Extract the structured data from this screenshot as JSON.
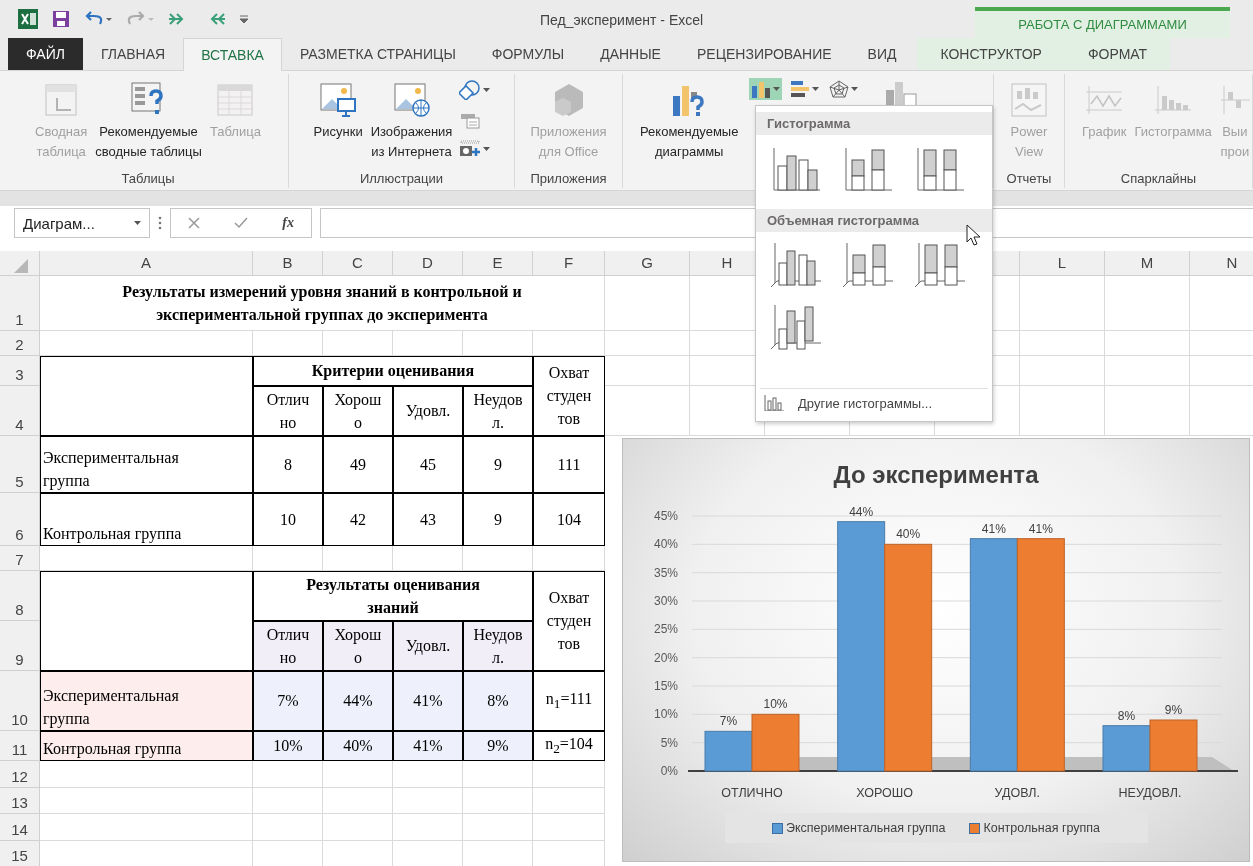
{
  "title_bar": {
    "title": "Пед_эксперимент - Excel",
    "context_group": "РАБОТА С ДИАГРАММАМИ"
  },
  "tabs": [
    {
      "label": "ФАЙЛ",
      "kind": "file",
      "selected": false
    },
    {
      "label": "ГЛАВНАЯ",
      "kind": "main",
      "selected": false
    },
    {
      "label": "ВСТАВКА",
      "kind": "main",
      "selected": true
    },
    {
      "label": "РАЗМЕТКА СТРАНИЦЫ",
      "kind": "main",
      "selected": false
    },
    {
      "label": "ФОРМУЛЫ",
      "kind": "main",
      "selected": false
    },
    {
      "label": "ДАННЫЕ",
      "kind": "main",
      "selected": false
    },
    {
      "label": "РЕЦЕНЗИРОВАНИЕ",
      "kind": "main",
      "selected": false
    },
    {
      "label": "ВИД",
      "kind": "main",
      "selected": false
    },
    {
      "label": "КОНСТРУКТОР",
      "kind": "context",
      "selected": false
    },
    {
      "label": "ФОРМАТ",
      "kind": "context",
      "selected": false
    }
  ],
  "ribbon_groups": [
    {
      "label": "Таблицы",
      "buttons": [
        {
          "kind": "pivot",
          "label": "Сводная\nтаблица",
          "disabled": true
        },
        {
          "kind": "recommended-pivot",
          "label": "Рекомендуемые\nсводные таблицы",
          "disabled": false
        },
        {
          "kind": "table",
          "label": "Таблица",
          "disabled": true
        }
      ]
    },
    {
      "label": "Иллюстрации",
      "buttons": [
        {
          "kind": "pictures",
          "label": "Рисунки",
          "disabled": false
        },
        {
          "kind": "online-pictures",
          "label": "Изображения\nиз Интернета",
          "disabled": false
        }
      ],
      "small_tools": [
        {
          "kind": "shapes"
        },
        {
          "kind": "smartart"
        },
        {
          "kind": "screenshot"
        }
      ]
    },
    {
      "label": "Приложения",
      "buttons": [
        {
          "kind": "apps",
          "label": "Приложения\nдля Office",
          "disabled": true
        }
      ]
    },
    {
      "buttons": [
        {
          "kind": "recommended-charts",
          "label": "Рекомендуемые\nдиаграммы",
          "disabled": false
        }
      ],
      "chart_types": [
        {
          "kind": "column",
          "expanded": true
        },
        {
          "kind": "bar",
          "expanded": false
        },
        {
          "kind": "radar",
          "expanded": false
        }
      ]
    },
    {
      "label": "Отчеты",
      "buttons": [
        {
          "kind": "power-view",
          "label": "Power\nView",
          "disabled": true
        }
      ]
    },
    {
      "label": "Спарклайны",
      "buttons": [
        {
          "kind": "sparkline-line",
          "label": "График",
          "disabled": true
        },
        {
          "kind": "sparkline-column",
          "label": "Гистограмма",
          "disabled": true
        },
        {
          "kind": "sparkline-winloss",
          "label": "Выи\nпрои",
          "disabled": true
        }
      ]
    }
  ],
  "formula_bar": {
    "name_box": "Диаграм...",
    "function_label": "fx"
  },
  "sheet": {
    "column_headers": [
      "A",
      "B",
      "C",
      "D",
      "E",
      "F",
      "G",
      "H"
    ],
    "column_headers_right": [
      "L",
      "M",
      "N"
    ],
    "row_headers": [
      "1",
      "2",
      "3",
      "4",
      "5",
      "6",
      "7",
      "8",
      "9",
      "10",
      "11",
      "12",
      "13",
      "14",
      "15"
    ],
    "title": "Результаты измерений уровня знаний в контрольной и\nэкспериментальной группах до эксперимента",
    "tables": [
      {
        "highlighted": false,
        "header": "Критерии оценивания",
        "coverage_header": "Охват\nстуден\nтов",
        "columns": [
          "Отлич\nно",
          "Хорош\nо",
          "Удовл.",
          "Неудов\nл."
        ],
        "rows": [
          {
            "label": "Экспериментальная\nгруппа",
            "values": [
              "8",
              "49",
              "45",
              "9"
            ],
            "coverage": "111"
          },
          {
            "label": "Контрольная группа",
            "values": [
              "10",
              "42",
              "43",
              "9"
            ],
            "coverage": "104"
          }
        ]
      },
      {
        "highlighted": true,
        "header": "Результаты оценивания\nзнаний",
        "coverage_header": "Охват\nстуден\nтов",
        "columns": [
          "Отлич\nно",
          "Хорош\nо",
          "Удовл.",
          "Неудов\nл."
        ],
        "rows": [
          {
            "label": "Экспериментальная\nгруппа",
            "values": [
              "7%",
              "44%",
              "41%",
              "8%"
            ],
            "coverage": "n$_{1}$=111"
          },
          {
            "label": "Контрольная группа",
            "values": [
              "10%",
              "40%",
              "41%",
              "9%"
            ],
            "coverage": "n$_{2}$=104"
          }
        ]
      }
    ]
  },
  "chart": {
    "title": "До эксперимента",
    "chart_data": {
      "type": "bar",
      "categories": [
        "ОТЛИЧНО",
        "ХОРОШО",
        "УДОВЛ.",
        "НЕУДОВЛ."
      ],
      "series": [
        {
          "name": "Экспериментальная группа",
          "color": "#5b9bd5",
          "values": [
            7,
            44,
            41,
            8
          ]
        },
        {
          "name": "Контрольная группа",
          "color": "#ed7d31",
          "values": [
            10,
            40,
            41,
            9
          ]
        }
      ],
      "ylim": [
        0,
        45
      ],
      "yticks": [
        {
          "value": 0,
          "label": "0%"
        },
        {
          "value": 5,
          "label": "5%"
        },
        {
          "value": 10,
          "label": "10%"
        },
        {
          "value": 15,
          "label": "15%"
        },
        {
          "value": 20,
          "label": "20%"
        },
        {
          "value": 25,
          "label": "25%"
        },
        {
          "value": 30,
          "label": "30%"
        },
        {
          "value": 35,
          "label": "35%"
        },
        {
          "value": 40,
          "label": "40%"
        },
        {
          "value": 45,
          "label": "45%"
        }
      ],
      "grid": true,
      "value_labels": [
        [
          "7%",
          "44%",
          "41%",
          "8%"
        ],
        [
          "10%",
          "40%",
          "41%",
          "9%"
        ]
      ]
    }
  },
  "column_menu": {
    "sections": [
      {
        "title": "Гистограмма",
        "items": [
          {
            "kind": "clustered"
          },
          {
            "kind": "stacked"
          },
          {
            "kind": "stacked-100"
          }
        ]
      },
      {
        "title": "Объемная гистограмма",
        "items": [
          {
            "kind": "clustered-3d"
          },
          {
            "kind": "stacked-3d"
          },
          {
            "kind": "stacked-100-3d"
          },
          {
            "kind": "column-3d"
          }
        ]
      }
    ],
    "more": "Другие гистограммы..."
  }
}
